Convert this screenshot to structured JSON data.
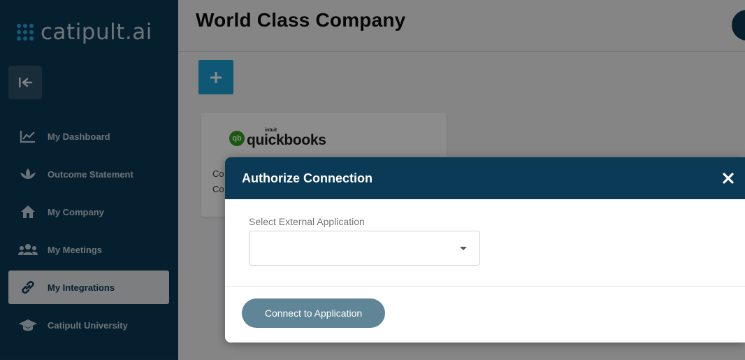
{
  "app": {
    "logo_text": "catipult.ai",
    "page_title": "World Class Company"
  },
  "sidebar": {
    "items": [
      {
        "label": "My Dashboard",
        "icon": "chart-line-icon",
        "active": false
      },
      {
        "label": "Outcome Statement",
        "icon": "lotus-icon",
        "active": false
      },
      {
        "label": "My Company",
        "icon": "house-icon",
        "active": false
      },
      {
        "label": "My Meetings",
        "icon": "users-icon",
        "active": false
      },
      {
        "label": "My Integrations",
        "icon": "link-icon",
        "active": true
      },
      {
        "label": "Catipult University",
        "icon": "graduation-cap-icon",
        "active": false
      }
    ]
  },
  "integration_card": {
    "brand_small": "intuit",
    "brand_name": "quickbooks",
    "brand_mark": "qb",
    "line1_prefix": "Co",
    "line2_prefix": "Co"
  },
  "modal": {
    "title": "Authorize Connection",
    "field_label": "Select External Application",
    "selected_value": "",
    "connect_label": "Connect to Application"
  },
  "colors": {
    "sidebar": "#0b3a56",
    "accent": "#1b9fd6",
    "button": "#5f8597",
    "quickbooks_green": "#2ca01c"
  }
}
